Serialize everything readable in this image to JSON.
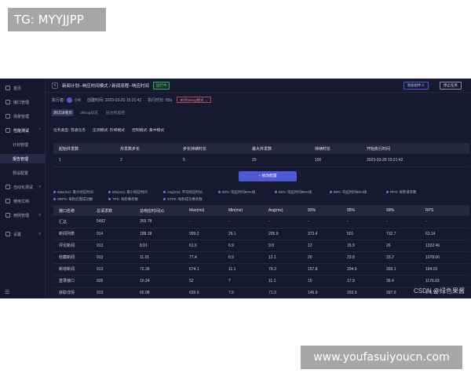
{
  "overlays": {
    "top_badge": "TG: MYYJJPP",
    "bottom_badge": "www.youfasuiyoucn.com",
    "watermark": "CSDN @绿色果酱"
  },
  "sidebar": {
    "items": [
      {
        "label": "首页",
        "icon": "home-icon"
      },
      {
        "label": "接口管理",
        "icon": "api-icon"
      },
      {
        "label": "场景管理",
        "icon": "scene-icon"
      },
      {
        "label": "性能测试",
        "icon": "performance-icon",
        "chevron": "^"
      },
      {
        "label": "自动化测试",
        "icon": "automation-icon",
        "chevron": "v"
      },
      {
        "label": "使用文档",
        "icon": "doc-icon"
      },
      {
        "label": "用例管理",
        "icon": "case-icon",
        "chevron": "v"
      },
      {
        "label": "设置",
        "icon": "gear-icon",
        "chevron": "v"
      }
    ],
    "subitems": [
      "计划管理",
      "报告管理",
      "预设配置"
    ],
    "menu_icon": "☰"
  },
  "header": {
    "breadcrumb": "新闻计划--响应时间模式 / 新闻流程--响应时间",
    "status": "运行中",
    "add_component": "添加组件人",
    "stop": "停止任务"
  },
  "meta": {
    "executor_label": "执行者:",
    "executor_name": "小R",
    "created_label": "创建时间: 2023-03-20 15:21:42",
    "duration_label": "执行时长: 55s",
    "debug_select": "关闭debug模式 ⌄"
  },
  "tabs": [
    "测试详情页",
    "debug日志",
    "压力机监控"
  ],
  "config": [
    "任务类型: 普通任务",
    "压测模式: 阶梯模式",
    "控制模式: 集中模式"
  ],
  "stage_table": {
    "headers": [
      "起始并发数",
      "并发数步长",
      "步长持续时长",
      "最大并发数",
      "持续时长",
      "开始执行时间"
    ],
    "row": [
      "1",
      "2",
      "5",
      "20",
      "100",
      "2023-03-20 15:21:42"
    ]
  },
  "edit_button": "+ 修改配置",
  "legend": [
    "Max(ms): 最大响应时间",
    "Min(ms): 最小响应时间",
    "Avg(ms): 平均响应时长",
    "90%: 响应时间90%线",
    "95%: 响应时间95%线",
    "99%: 响应时间99%线",
    "RPS: 每秒请求数",
    "SRPS: 每秒启警成功数",
    "TPS: 每秒事务数",
    "STPS: 每秒成功事务数"
  ],
  "stats_table": {
    "headers": [
      "接口名称",
      "总请求数",
      "总响应时间(s)",
      "Max(ms)",
      "Min(ms)",
      "Avg(ms)",
      "90%",
      "95%",
      "99%",
      "RPS"
    ],
    "rows": [
      [
        "汇总",
        "5492",
        "355.78",
        "-",
        "-",
        "-",
        "-",
        "-",
        "-",
        "-"
      ],
      [
        "新闻列表",
        "914",
        "188.18",
        "999.2",
        "26.1",
        "205.9",
        "373.4",
        "501",
        "732.7",
        "63.14"
      ],
      [
        "评论新闻",
        "913",
        "8.91",
        "61.6",
        "6.9",
        "9.8",
        "12",
        "15.9",
        "26",
        "1332.46"
      ],
      [
        "收藏新闻",
        "913",
        "11.01",
        "77.4",
        "6.9",
        "12.1",
        "20",
        "23.8",
        "33.2",
        "1078.06"
      ],
      [
        "新增新闻",
        "913",
        "72.36",
        "674.1",
        "11.1",
        "79.3",
        "157.8",
        "204.6",
        "393.1",
        "164.03"
      ],
      [
        "登录接口",
        "926",
        "10.24",
        "52",
        "7",
        "11.1",
        "15",
        "17.9",
        "36.4",
        "1176.03"
      ],
      [
        "获取详情",
        "913",
        "65.08",
        "639.9",
        "7.5",
        "71.3",
        "146.9",
        "203.3",
        "397.9",
        "176.15"
      ]
    ]
  }
}
